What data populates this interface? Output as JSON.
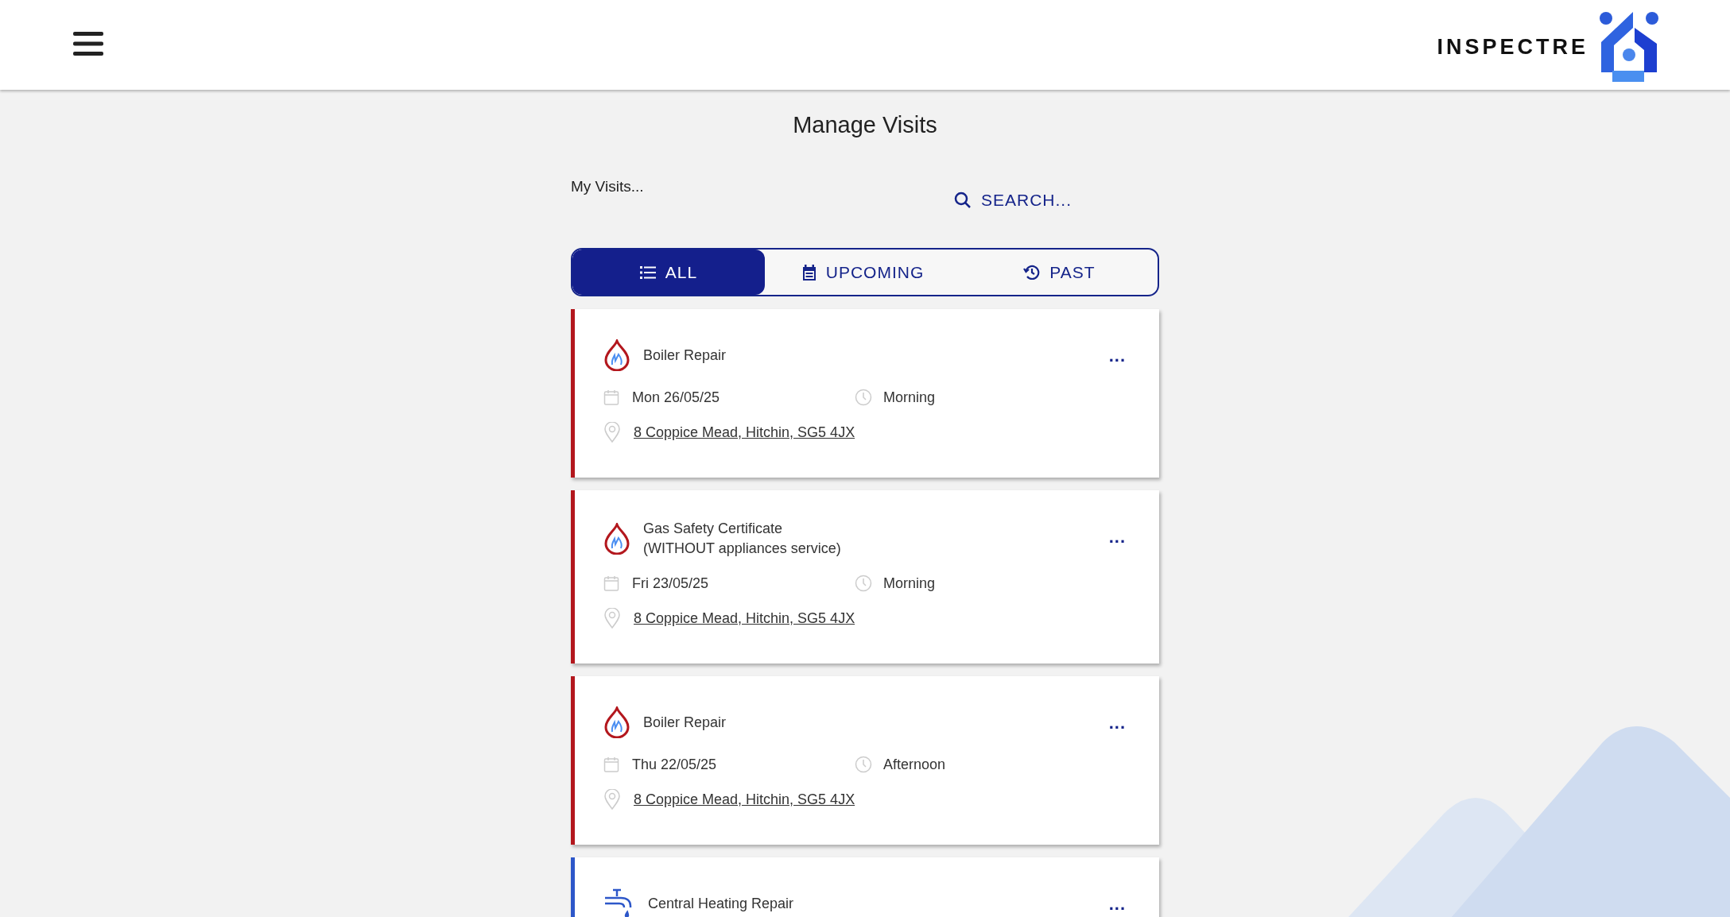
{
  "header": {
    "brand": "INSPECTRE"
  },
  "page_title": "Manage Visits",
  "subtitle": "My Visits...",
  "search": {
    "label": "SEARCH..."
  },
  "tabs": [
    {
      "label": "ALL",
      "kind": "list",
      "selected": true
    },
    {
      "label": "UPCOMING",
      "kind": "calendar",
      "selected": false
    },
    {
      "label": "PAST",
      "kind": "history",
      "selected": false
    }
  ],
  "visits": [
    {
      "kind": "gas",
      "title": "Boiler Repair",
      "date": "Mon 26/05/25",
      "time": "Morning",
      "address": "8 Coppice Mead, Hitchin, SG5 4JX"
    },
    {
      "kind": "gas",
      "title": "Gas Safety Certificate\n(WITHOUT appliances service)",
      "date": "Fri 23/05/25",
      "time": "Morning",
      "address": "8 Coppice Mead, Hitchin, SG5 4JX"
    },
    {
      "kind": "gas",
      "title": "Boiler Repair",
      "date": "Thu 22/05/25",
      "time": "Afternoon",
      "address": "8 Coppice Mead, Hitchin, SG5 4JX"
    },
    {
      "kind": "plumbing",
      "title": "Central Heating Repair"
    }
  ],
  "more_label": "..."
}
